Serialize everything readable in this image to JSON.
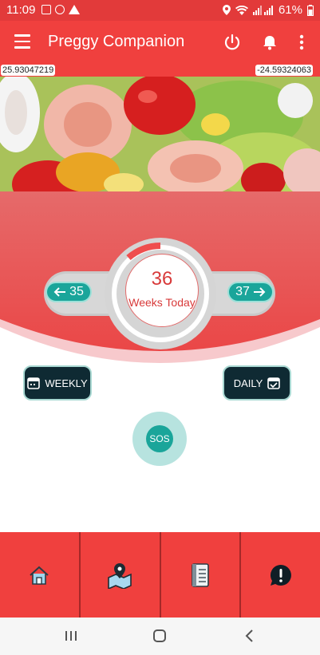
{
  "status_bar": {
    "time": "11:09",
    "battery": "61%"
  },
  "app_bar": {
    "title": "Preggy Companion"
  },
  "coordinates": {
    "latitude": "25.93047219",
    "longitude": "-24.59324063"
  },
  "week_tracker": {
    "current_week": "36",
    "current_label": "Weeks Today",
    "prev_week": "35",
    "next_week": "37"
  },
  "view_modes": {
    "weekly_label": "WEEKLY",
    "daily_label": "DAILY"
  },
  "sos": {
    "label": "SOS"
  },
  "bottom_nav": {
    "items": [
      "home-icon",
      "map-location-icon",
      "notebook-icon",
      "alert-chat-icon"
    ]
  },
  "colors": {
    "primary": "#f0403e",
    "teal": "#1aa59a",
    "dark": "#0f2a33"
  }
}
